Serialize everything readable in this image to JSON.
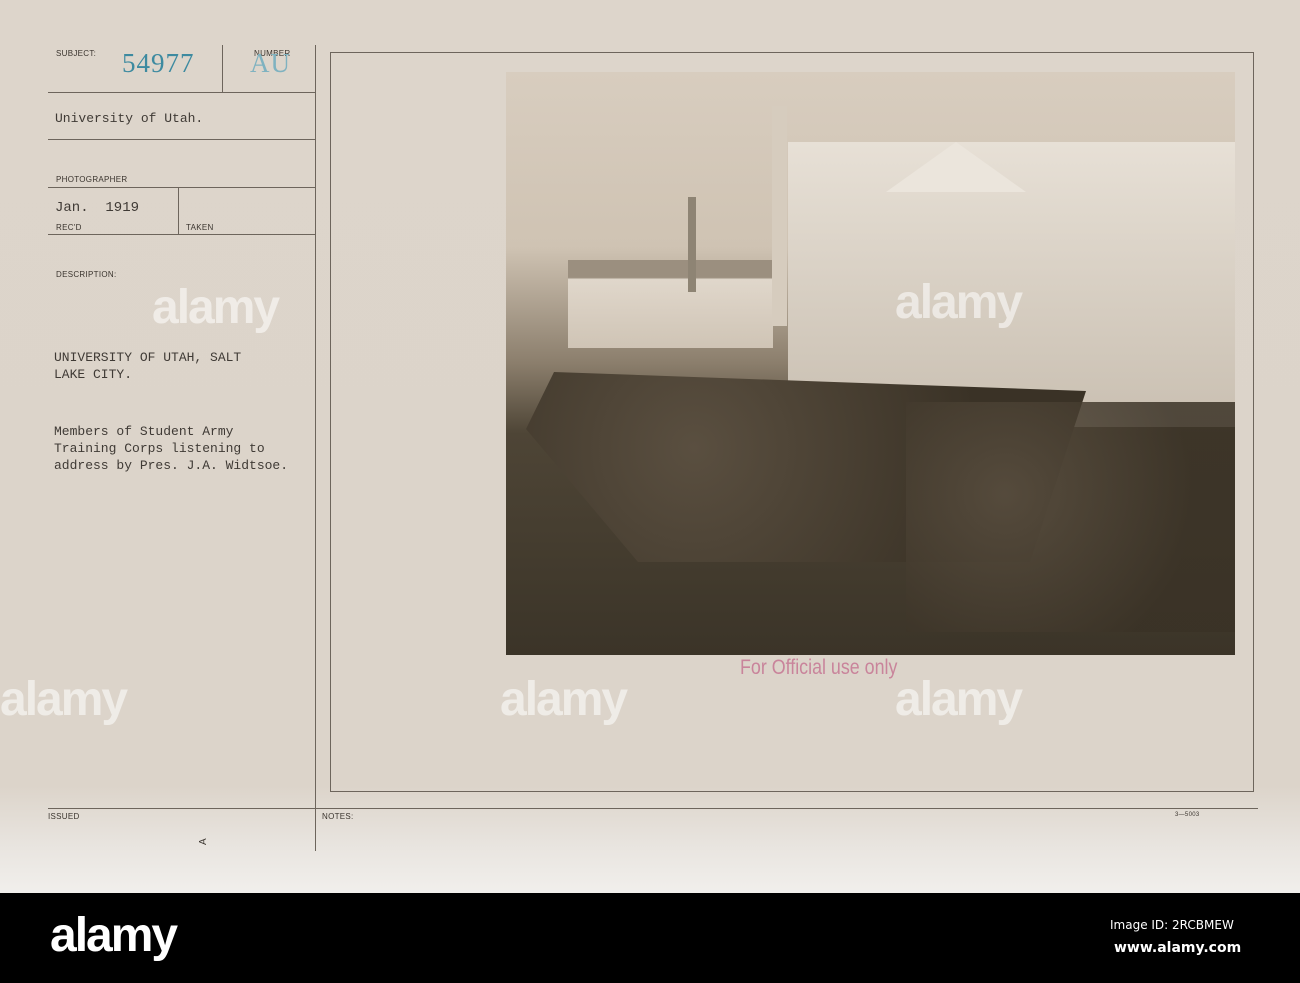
{
  "card": {
    "subject_label": "SUBJECT:",
    "subject_number": "54977",
    "number_label": "NUMBER",
    "number_value": "AU",
    "subject_text": "University of Utah.",
    "photographer_label": "PHOTOGRAPHER",
    "recd_date": "Jan.  1919",
    "recd_label": "REC'D",
    "taken_label": "TAKEN",
    "description_label": "DESCRIPTION:",
    "description_title": "UNIVERSITY OF UTAH, SALT\nLAKE CITY.",
    "description_body": "Members of Student Army\nTraining Corps listening to\naddress by Pres. J.A. Widtsoe.",
    "issued_label": "ISSUED",
    "notes_label": "NOTES:",
    "form_number": "3—5003",
    "stamp": "For Official use only",
    "issued_mark": "A"
  },
  "watermark": "alamy",
  "footer": {
    "logo": "alamy",
    "image_id": "Image ID: 2RCBMEW",
    "url": "www.alamy.com"
  }
}
